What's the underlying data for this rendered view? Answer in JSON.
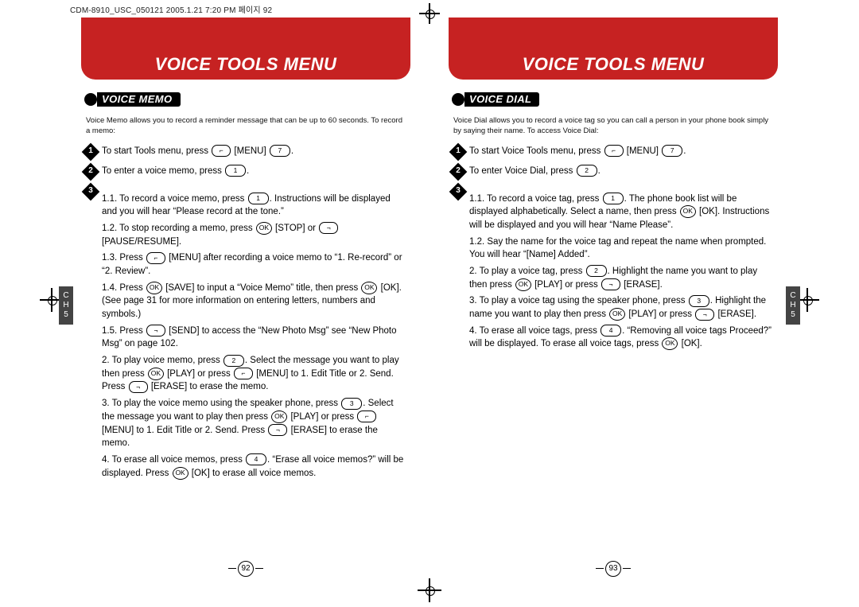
{
  "meta": {
    "header": "CDM-8910_USC_050121  2005.1.21  7:20 PM  페이지 92"
  },
  "side_tab": {
    "c": "C",
    "h": "H",
    "n": "5"
  },
  "left": {
    "banner": "VOICE TOOLS MENU",
    "section": "VOICE MEMO",
    "intro": "Voice Memo allows you to record a reminder message that can be up to 60 seconds. To record a memo:",
    "step1": "To start Tools menu, press",
    "step1_b": "[MENU]",
    "step2": "To enter a voice memo, press",
    "s3_11": "1.1. To record a voice memo, press",
    "s3_11_b": ". Instructions will be displayed and you will hear “Please record at the tone.”",
    "s3_12": "1.2. To stop recording a memo, press",
    "s3_12_b": "[STOP] or",
    "s3_12_c": "[PAUSE/RESUME].",
    "s3_13": "1.3. Press",
    "s3_13_b": "[MENU] after recording a voice memo to “1. Re-record” or “2. Review”.",
    "s3_14": "1.4. Press",
    "s3_14_b": "[SAVE] to input a “Voice Memo” title, then press",
    "s3_14_c": "[OK]. (See page 31 for more information on entering letters, numbers and symbols.)",
    "s3_15": "1.5. Press",
    "s3_15_b": "[SEND] to access the “New Photo Msg” see “New Photo Msg” on page 102.",
    "s3_2": "2. To play voice memo, press",
    "s3_2_b": ". Select the message you want to play then press",
    "s3_2_c": "[PLAY] or press",
    "s3_2_d": "[MENU] to 1. Edit Title or 2. Send. Press",
    "s3_2_e": "[ERASE] to erase the memo.",
    "s3_3": "3. To play the voice memo using the speaker phone, press",
    "s3_3_b": ". Select the message you want to play then press",
    "s3_3_c": "[PLAY] or press",
    "s3_3_d": "[MENU] to 1. Edit Title or 2. Send. Press",
    "s3_3_e": "[ERASE] to erase the memo.",
    "s3_4": "4. To erase all voice memos, press",
    "s3_4_b": ". “Erase all voice memos?” will be displayed. Press",
    "s3_4_c": "[OK] to erase all voice memos.",
    "page_num": "92"
  },
  "right": {
    "banner": "VOICE TOOLS MENU",
    "section": "VOICE DIAL",
    "intro": "Voice Dial allows you to record a voice tag so you can call a person in your phone book simply by saying their name. To access Voice Dial:",
    "step1": "To start Voice Tools menu, press",
    "step1_b": "[MENU]",
    "step2": "To enter Voice Dial, press",
    "s3_11": "1.1. To record a voice tag, press",
    "s3_11_b": ". The phone book list will be displayed alphabetically. Select a name, then press",
    "s3_11_c": "[OK]. Instructions will be displayed and you will hear “Name Please”.",
    "s3_12": "1.2. Say the name for the voice tag and repeat the name when prompted. You will hear “[Name] Added”.",
    "s3_2": "2. To play a voice tag, press",
    "s3_2_b": ". Highlight the name you want to play then press",
    "s3_2_c": "[PLAY] or press",
    "s3_2_d": "[ERASE].",
    "s3_3": "3. To play a voice tag using the speaker phone, press",
    "s3_3_b": ". Highlight the name you want to play then press",
    "s3_3_c": "[PLAY] or press",
    "s3_3_d": "[ERASE].",
    "s3_4": "4. To erase all voice tags, press",
    "s3_4_b": ". “Removing all voice tags Proceed?” will be displayed. To erase all voice tags, press",
    "s3_4_c": "[OK].",
    "page_num": "93"
  },
  "keys": {
    "softleft": "⌐",
    "softright": "¬",
    "menu": "⌐",
    "ok": "OK",
    "k1": "1",
    "k2": "2",
    "k3": "3",
    "k4": "4",
    "k7": "7"
  }
}
